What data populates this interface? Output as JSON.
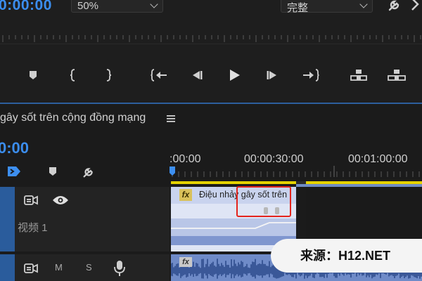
{
  "monitor": {
    "timecode": "0:00:00",
    "zoom": "50%",
    "quality": "完整",
    "icons": [
      "wrench-icon",
      "panel-menu-icon"
    ],
    "controls": [
      "add-marker-icon",
      "mark-in-icon",
      "mark-out-icon",
      "go-to-in-icon",
      "step-back-icon",
      "play-icon",
      "step-forward-icon",
      "go-to-out-icon",
      "lift-icon",
      "extract-icon"
    ]
  },
  "timeline": {
    "sequence_title": "gây sốt trên cộng đồng mạng",
    "timecode": "0:00",
    "ruler_labels": [
      ":00:00",
      "00:00:30:00",
      "00:01:00:00"
    ],
    "video_track": {
      "name": "视频 1"
    },
    "audio_track": {
      "mute": "M",
      "solo": "S"
    },
    "clip": {
      "fx": "fx",
      "name": "Điệu nhảy gây sốt trên"
    }
  },
  "watermark": {
    "text": "来源：H12.NET"
  },
  "colors": {
    "accent": "#3b8ded",
    "highlight_box": "#e4241d",
    "clip": "#8fa4d6",
    "work_area": "#e5d200"
  }
}
